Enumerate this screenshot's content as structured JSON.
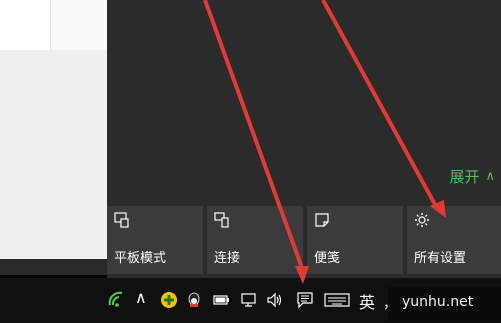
{
  "action_center": {
    "expand_label": "展开",
    "tiles": [
      {
        "label": "平板模式",
        "icon": "tablet-mode-icon"
      },
      {
        "label": "连接",
        "icon": "connect-icon"
      },
      {
        "label": "便笺",
        "icon": "note-icon"
      },
      {
        "label": "所有设置",
        "icon": "gear-icon"
      }
    ]
  },
  "taskbar": {
    "ime": "英",
    "punct": "，",
    "icons": [
      "wifi-icon",
      "chevron-up-icon",
      "security-icon",
      "qq-icon",
      "battery-icon",
      "network-icon",
      "volume-icon",
      "action-center-icon",
      "keyboard-icon"
    ]
  },
  "watermark": {
    "text": "yunhu.net"
  },
  "colors": {
    "panel": "#2b2b2b",
    "tile": "#3b3b3b",
    "accent": "#59b86b",
    "annotation": "#e53935"
  }
}
